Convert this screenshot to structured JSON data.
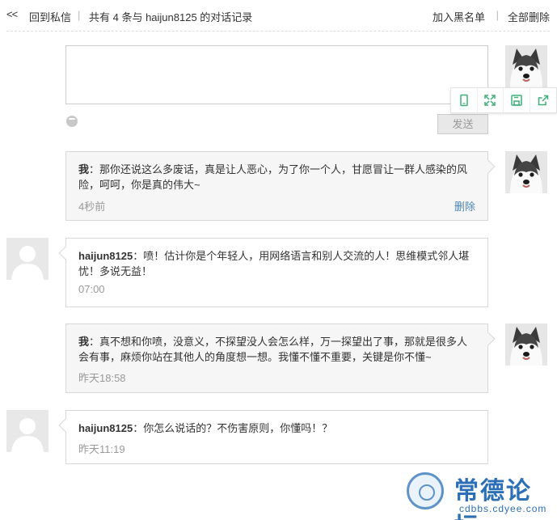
{
  "header": {
    "back_glyph": "<<",
    "back_label": "回到私信",
    "separator": "|",
    "conversation_count": "共有 4 条与 haijun8125 的对话记录",
    "block_label": "加入黑名单",
    "delete_all_label": "全部删除"
  },
  "compose": {
    "value": "",
    "send_label": "发送",
    "emoji_icon": "smiley-icon"
  },
  "toolbar": {
    "icons": [
      "phone-icon",
      "fullscreen-icon",
      "save-icon",
      "share-icon"
    ]
  },
  "messages": [
    {
      "side": "mine",
      "sender": "我",
      "text": "：那你还说这么多废话，真是让人恶心，为了你一个人，甘愿冒让一群人感染的风险，呵呵，你是真的伟大~",
      "time": "4秒前",
      "delete_label": "删除"
    },
    {
      "side": "theirs",
      "sender": "haijun8125",
      "text": "：喷！估计你是个年轻人，用网络语言和别人交流的人！思维模式邻人堪忧！多说无益！",
      "time": "07:00"
    },
    {
      "side": "mine",
      "sender": "我",
      "text": "：真不想和你喷，没意义，不探望没人会怎么样，万一探望出了事，那就是很多人会有事，麻烦你站在其他人的角度想一想。我懂不懂不重要，关键是你不懂~",
      "time": "昨天18:58"
    },
    {
      "side": "theirs",
      "sender": "haijun8125",
      "text": "：你怎么说话的？不伤害原则，你懂吗！？",
      "time": "昨天11:19"
    }
  ],
  "watermark": {
    "name": "常德论坛",
    "url": "cdbbs.cdyee.com"
  },
  "colors": {
    "link": "#4a86b8",
    "watermark": "#2c6fb6",
    "mine_bubble": "#f6f6f6"
  }
}
